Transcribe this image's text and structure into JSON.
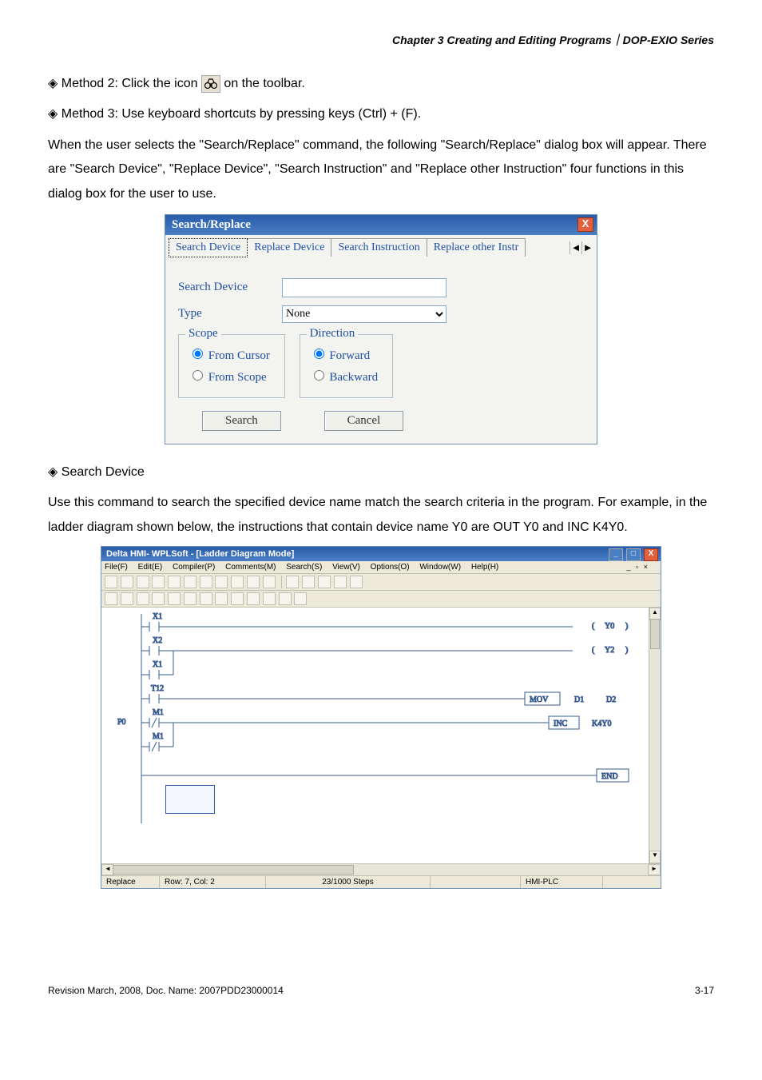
{
  "header": "Chapter 3 Creating and Editing Programs｜DOP-EXIO Series",
  "bullets": {
    "m2a": "Method 2: Click the icon",
    "m2b": "on the toolbar.",
    "m3": "Method 3: Use keyboard shortcuts by pressing keys (Ctrl) + (F)."
  },
  "para1": "When the user selects the \"Search/Replace\" command, the following \"Search/Replace\" dialog box will appear. There are \"Search Device\", \"Replace Device\", \"Search Instruction\" and \"Replace other Instruction\" four functions in this dialog box for the user to use.",
  "dialog": {
    "title": "Search/Replace",
    "tabs": [
      "Search Device",
      "Replace Device",
      "Search Instruction",
      "Replace other Instr"
    ],
    "field_search_label": "Search Device",
    "field_search_value": "",
    "field_type_label": "Type",
    "field_type_value": "None",
    "scope": {
      "title": "Scope",
      "opt1": "From Cursor",
      "opt2": "From Scope"
    },
    "direction": {
      "title": "Direction",
      "opt1": "Forward",
      "opt2": "Backward"
    },
    "btn_search": "Search",
    "btn_cancel": "Cancel"
  },
  "section2_title": "Search Device",
  "para2": "Use this command to search the specified device name match the search criteria in the program. For example, in the ladder diagram shown below, the instructions that contain device name Y0 are OUT Y0 and INC K4Y0.",
  "app": {
    "title": "Delta HMI- WPLSoft - [Ladder Diagram Mode]",
    "menu": [
      "File(F)",
      "Edit(E)",
      "Compiler(P)",
      "Comments(M)",
      "Search(S)",
      "View(V)",
      "Options(O)",
      "Window(W)",
      "Help(H)"
    ],
    "ladder_labels": {
      "X1a": "X1",
      "X2": "X2",
      "X1b": "X1",
      "T12": "T12",
      "M1a": "M1",
      "M1b": "M1",
      "P0": "P0",
      "Y0": "Y0",
      "Y2": "Y2",
      "MOV": "MOV",
      "D1": "D1",
      "D2": "D2",
      "INC": "INC",
      "K4Y0": "K4Y0",
      "END": "END"
    },
    "status": {
      "mode": "Replace",
      "rowcol": "Row: 7, Col: 2",
      "steps": "23/1000 Steps",
      "target": "HMI-PLC"
    }
  },
  "footer": {
    "left": "Revision March, 2008, Doc. Name: 2007PDD23000014",
    "right": "3-17"
  }
}
